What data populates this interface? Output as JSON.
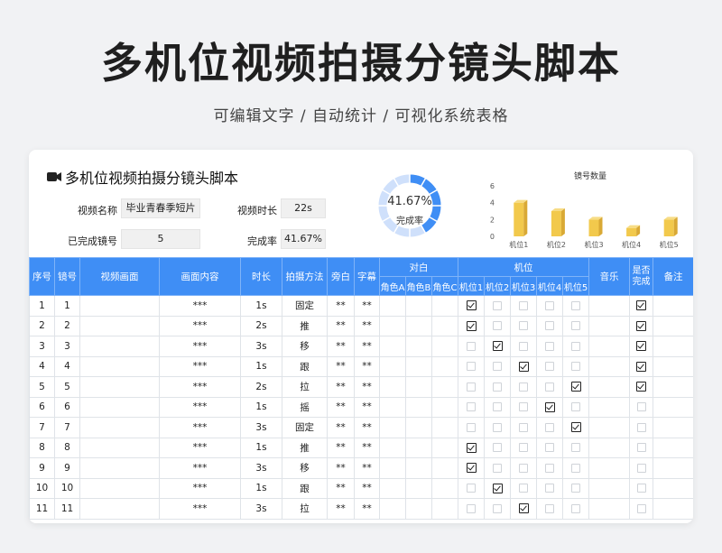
{
  "page": {
    "title": "多机位视频拍摄分镜头脚本",
    "subtitle": "可编辑文字 / 自动统计 / 可视化系统表格"
  },
  "card": {
    "title": "多机位视频拍摄分镜头脚本",
    "icon": "video-camera-icon",
    "fields": {
      "video_name_label": "视频名称",
      "video_name": "毕业青春季短片",
      "duration_label": "视频时长",
      "duration": "22s",
      "done_label": "已完成镜号",
      "done": "5",
      "rate_label": "完成率",
      "rate": "41.67%"
    },
    "donut": {
      "value": 0.4167,
      "pct_text": "41.67%",
      "label": "完成率",
      "color": "#3f8ef5",
      "track": "#cfe0fb"
    }
  },
  "chart_data": {
    "type": "bar",
    "title": "镜号数量",
    "categories": [
      "机位1",
      "机位2",
      "机位3",
      "机位4",
      "机位5"
    ],
    "values": [
      4,
      3,
      2,
      1,
      2
    ],
    "ylim": [
      0,
      6
    ],
    "yticks": [
      "0",
      "2",
      "4",
      "6"
    ],
    "color": "#f2c94c"
  },
  "table": {
    "headers": {
      "seq": "序号",
      "shot": "镜号",
      "frame": "视频画面",
      "content": "画面内容",
      "dur": "时长",
      "method": "拍摄方法",
      "voice": "旁白",
      "subtitle": "字幕",
      "dialog": "对白",
      "camera": "机位",
      "music": "音乐",
      "done": "是否完成",
      "note": "备注"
    },
    "dialog_cols": [
      "角色A",
      "角色B",
      "角色C"
    ],
    "camera_cols": [
      "机位1",
      "机位2",
      "机位3",
      "机位4",
      "机位5"
    ],
    "rows": [
      {
        "seq": "1",
        "shot": "1",
        "content": "***",
        "dur": "1s",
        "method": "固定",
        "voice": "**",
        "sub": "**",
        "cam": [
          1,
          0,
          0,
          0,
          0
        ],
        "done": 1
      },
      {
        "seq": "2",
        "shot": "2",
        "content": "***",
        "dur": "2s",
        "method": "推",
        "voice": "**",
        "sub": "**",
        "cam": [
          1,
          0,
          0,
          0,
          0
        ],
        "done": 1
      },
      {
        "seq": "3",
        "shot": "3",
        "content": "***",
        "dur": "3s",
        "method": "移",
        "voice": "**",
        "sub": "**",
        "cam": [
          0,
          1,
          0,
          0,
          0
        ],
        "done": 1
      },
      {
        "seq": "4",
        "shot": "4",
        "content": "***",
        "dur": "1s",
        "method": "跟",
        "voice": "**",
        "sub": "**",
        "cam": [
          0,
          0,
          1,
          0,
          0
        ],
        "done": 1
      },
      {
        "seq": "5",
        "shot": "5",
        "content": "***",
        "dur": "2s",
        "method": "拉",
        "voice": "**",
        "sub": "**",
        "cam": [
          0,
          0,
          0,
          0,
          1
        ],
        "done": 1
      },
      {
        "seq": "6",
        "shot": "6",
        "content": "***",
        "dur": "1s",
        "method": "摇",
        "voice": "**",
        "sub": "**",
        "cam": [
          0,
          0,
          0,
          1,
          0
        ],
        "done": 0
      },
      {
        "seq": "7",
        "shot": "7",
        "content": "***",
        "dur": "3s",
        "method": "固定",
        "voice": "**",
        "sub": "**",
        "cam": [
          0,
          0,
          0,
          0,
          1
        ],
        "done": 0
      },
      {
        "seq": "8",
        "shot": "8",
        "content": "***",
        "dur": "1s",
        "method": "推",
        "voice": "**",
        "sub": "**",
        "cam": [
          1,
          0,
          0,
          0,
          0
        ],
        "done": 0
      },
      {
        "seq": "9",
        "shot": "9",
        "content": "***",
        "dur": "3s",
        "method": "移",
        "voice": "**",
        "sub": "**",
        "cam": [
          1,
          0,
          0,
          0,
          0
        ],
        "done": 0
      },
      {
        "seq": "10",
        "shot": "10",
        "content": "***",
        "dur": "1s",
        "method": "跟",
        "voice": "**",
        "sub": "**",
        "cam": [
          0,
          1,
          0,
          0,
          0
        ],
        "done": 0
      },
      {
        "seq": "11",
        "shot": "11",
        "content": "***",
        "dur": "3s",
        "method": "拉",
        "voice": "**",
        "sub": "**",
        "cam": [
          0,
          0,
          1,
          0,
          0
        ],
        "done": 0
      }
    ]
  }
}
